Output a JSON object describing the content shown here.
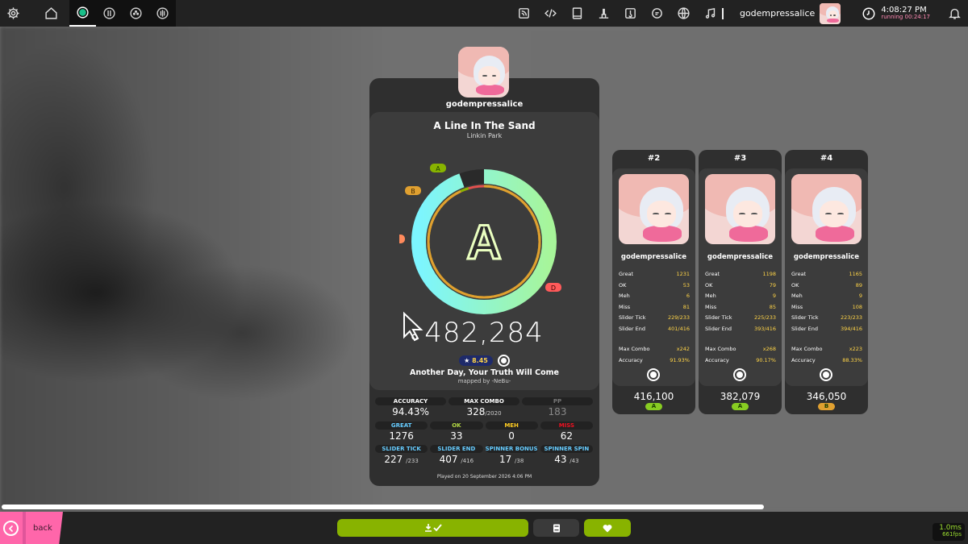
{
  "topbar": {
    "username": "godempressalice",
    "clock_time": "4:08:27 PM",
    "clock_running": "running 00:24:17"
  },
  "main": {
    "username": "godempressalice",
    "title": "A Line In The Sand",
    "artist": "Linkin Park",
    "grade": "A",
    "grade_markers": [
      "A",
      "B",
      "C",
      "D"
    ],
    "score": "482,284",
    "star_rating": "8.45",
    "difficulty": "Another Day, Your Truth Will Come",
    "mapper": "mapped by -NeBu-",
    "stats_row1": [
      {
        "label": "ACCURACY",
        "value": "94.43%",
        "sub": "",
        "color": "#ffffff"
      },
      {
        "label": "MAX COMBO",
        "value": "328",
        "sub": "/2020",
        "color": "#ffffff"
      },
      {
        "label": "PP",
        "value": "183",
        "sub": "",
        "color": "#888888"
      }
    ],
    "stats_row2": [
      {
        "label": "GREAT",
        "value": "1276",
        "sub": "",
        "color": "#66ccff"
      },
      {
        "label": "OK",
        "value": "33",
        "sub": "",
        "color": "#b3d944"
      },
      {
        "label": "MEH",
        "value": "0",
        "sub": "",
        "color": "#ffcc22"
      },
      {
        "label": "MISS",
        "value": "62",
        "sub": "",
        "color": "#ed1121"
      }
    ],
    "stats_row3": [
      {
        "label": "SLIDER TICK",
        "value": "227",
        "sub": "/233",
        "color": "#66ccff"
      },
      {
        "label": "SLIDER END",
        "value": "407",
        "sub": "/416",
        "color": "#66ccff"
      },
      {
        "label": "SPINNER BONUS",
        "value": "17",
        "sub": "/38",
        "color": "#66ccff"
      },
      {
        "label": "SPINNER SPIN",
        "value": "43",
        "sub": "/43",
        "color": "#66ccff"
      }
    ],
    "played": "Played on 20 September 2026 4:06 PM"
  },
  "side_cards": [
    {
      "rank": "#2",
      "username": "godempressalice",
      "great": "1231",
      "ok": "53",
      "meh": "6",
      "miss": "81",
      "slider_tick": "229/233",
      "slider_end": "401/416",
      "max_combo": "x242",
      "accuracy": "91.93%",
      "score": "416,100",
      "grade": "A",
      "grade_color": "#88cc22"
    },
    {
      "rank": "#3",
      "username": "godempressalice",
      "great": "1198",
      "ok": "79",
      "meh": "9",
      "miss": "85",
      "slider_tick": "225/233",
      "slider_end": "393/416",
      "max_combo": "x268",
      "accuracy": "90.17%",
      "score": "382,079",
      "grade": "A",
      "grade_color": "#88cc22"
    },
    {
      "rank": "#4",
      "username": "godempressalice",
      "great": "1165",
      "ok": "89",
      "meh": "9",
      "miss": "108",
      "slider_tick": "223/233",
      "slider_end": "394/416",
      "max_combo": "x223",
      "accuracy": "88.33%",
      "score": "346,050",
      "grade": "B",
      "grade_color": "#e0a030"
    }
  ],
  "side_labels": {
    "great": "Great",
    "ok": "OK",
    "meh": "Meh",
    "miss": "Miss",
    "slider_tick": "Slider Tick",
    "slider_end": "Slider End",
    "max_combo": "Max Combo",
    "accuracy": "Accuracy"
  },
  "bottombar": {
    "back_label": "back",
    "frame_time": "1.0ms",
    "fps": "661fps"
  },
  "progress": 0.79,
  "colors": {
    "accent_green": "#88b300",
    "back_pink": "#ff66aa"
  }
}
